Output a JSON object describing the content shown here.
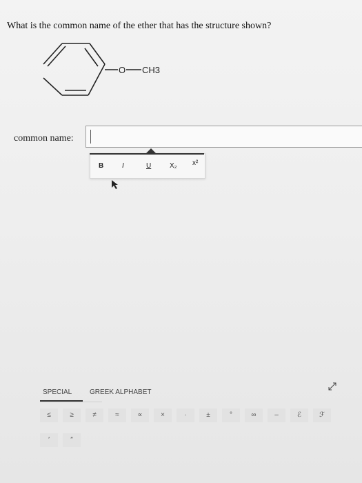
{
  "question": {
    "text": "What is the common name of the ether that has the structure shown?"
  },
  "structure": {
    "oxygen_label": "O",
    "methyl_label": "CH3"
  },
  "answer": {
    "label": "common name:",
    "value": "",
    "placeholder": ""
  },
  "toolbar": {
    "bold": "B",
    "italic": "I",
    "underline": "U",
    "subscript": "X₂",
    "superscript": "x²"
  },
  "tabs": {
    "special": "SPECIAL",
    "greek": "GREEK ALPHABET"
  },
  "symbols_row1": [
    "≤",
    "≥",
    "≠",
    "≈",
    "∝",
    "×",
    "·",
    "±",
    "°",
    "∞",
    "–",
    "ℰ",
    "ℱ"
  ],
  "symbols_row2": [
    "′",
    "″"
  ]
}
